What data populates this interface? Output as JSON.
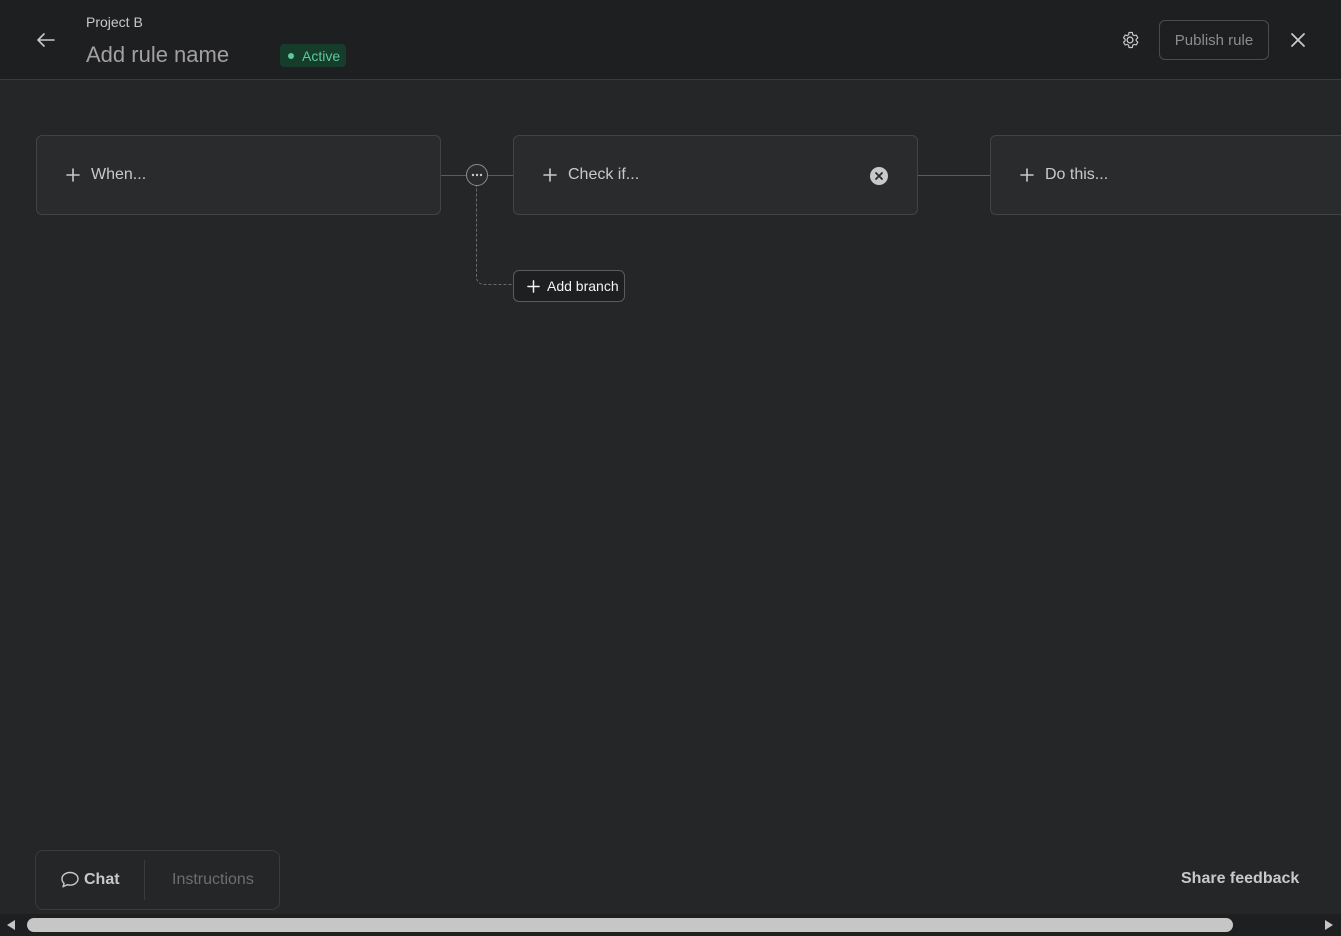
{
  "header": {
    "project": "Project B",
    "rule_name": "Add rule name",
    "status": "Active",
    "publish_label": "Publish rule"
  },
  "workflow": {
    "trigger_label": "When...",
    "condition_label": "Check if...",
    "action_label": "Do this...",
    "add_branch_label": "Add branch"
  },
  "footer": {
    "tabs": [
      {
        "label": "Chat",
        "active": true
      },
      {
        "label": "Instructions",
        "active": false
      }
    ],
    "share_feedback": "Share feedback"
  },
  "icons": {
    "back": "arrow-left-icon",
    "settings": "gear-icon",
    "close": "close-icon",
    "add": "plus-icon",
    "clear": "x-circle-icon",
    "more": "ellipsis-icon",
    "chat": "speech-bubble-icon"
  },
  "colors": {
    "background": "#252628",
    "topbar": "#1e1f21",
    "status_green": "#5dc99d",
    "status_bg": "#163c2c"
  }
}
